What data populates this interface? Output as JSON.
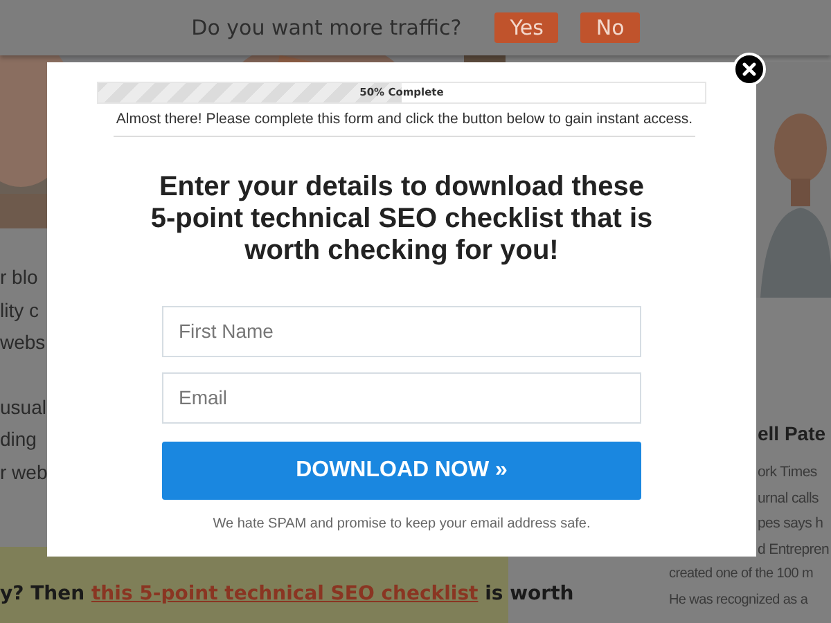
{
  "top_bar": {
    "question": "Do you want more traffic?",
    "buttons": [
      "Yes",
      "No"
    ]
  },
  "article": {
    "lines": [
      "r blo",
      "lity c",
      "webs",
      "usual",
      "ding",
      "r web"
    ],
    "callout": {
      "prefix": "y? Then",
      "link": "this 5-point technical SEO checklist",
      "suffix": "is worth"
    }
  },
  "sidebar": {
    "heading": "ell Pate",
    "partial_lines": [
      "ork Times",
      "urnal calls",
      "pes says h",
      "d Entrepren"
    ],
    "lines": [
      "created one of the 100 m",
      "He was recognized as a"
    ]
  },
  "modal": {
    "progress": {
      "label": "50% Complete",
      "level": 0.5
    },
    "notice": "Almost there! Please complete this form and click the button below to gain instant access.",
    "heading": [
      "Enter your details to download these",
      "5-point technical SEO checklist that is",
      "worth checking for you!"
    ],
    "fields": [
      {
        "placeholder": "First Name"
      },
      {
        "placeholder": "Email"
      }
    ],
    "button": "DOWNLOAD NOW »",
    "footer": "We hate SPAM and promise to keep your email address safe."
  }
}
